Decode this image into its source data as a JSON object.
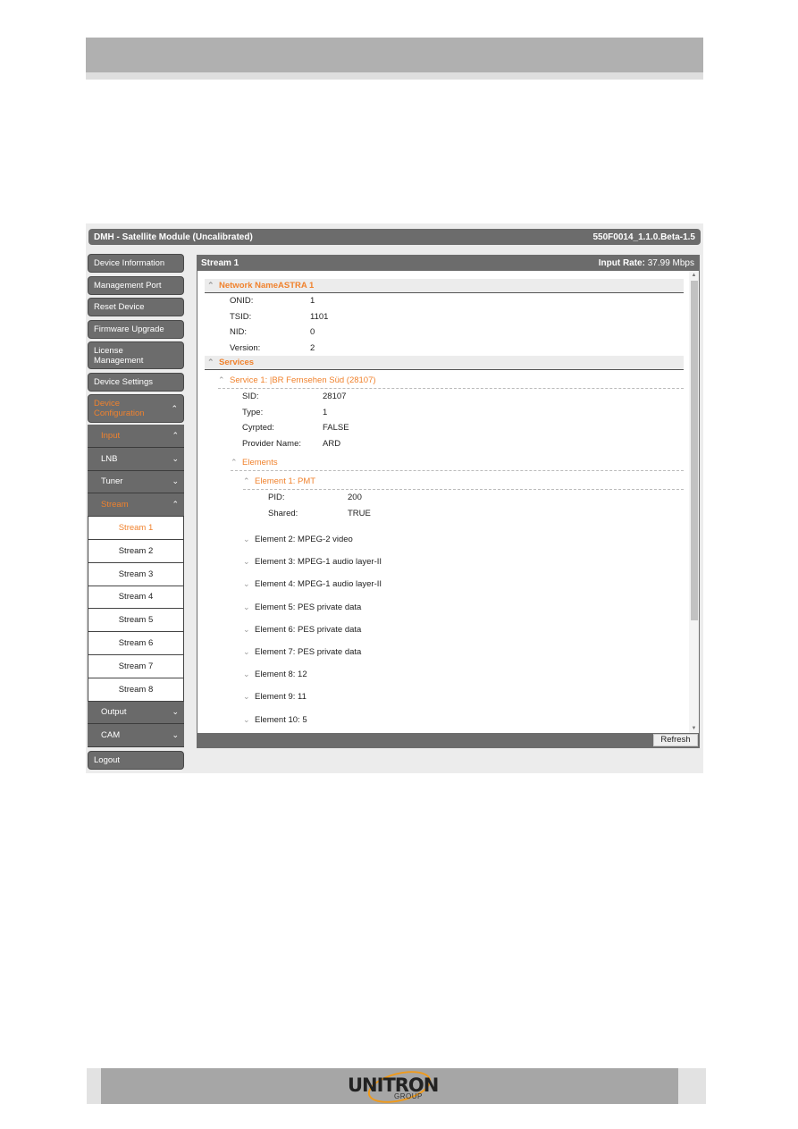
{
  "window": {
    "title": "DMH - Satellite Module (Uncalibrated)",
    "version": "550F0014_1.1.0.Beta-1.5"
  },
  "sidebar": {
    "items": [
      {
        "label": "Device Information"
      },
      {
        "label": "Management Port"
      },
      {
        "label": "Reset Device"
      },
      {
        "label": "Firmware Upgrade"
      },
      {
        "label": "License Management"
      },
      {
        "label": "Device Settings"
      },
      {
        "label": "Device Configuration",
        "expanded": true
      }
    ],
    "config": {
      "input": "Input",
      "lnb": "LNB",
      "tuner": "Tuner",
      "stream": "Stream",
      "streams": [
        "Stream 1",
        "Stream 2",
        "Stream 3",
        "Stream 4",
        "Stream 5",
        "Stream 6",
        "Stream 7",
        "Stream 8"
      ],
      "selected_stream": "Stream 1",
      "output": "Output",
      "cam": "CAM"
    },
    "logout": "Logout"
  },
  "content": {
    "title": "Stream 1",
    "input_rate_label": "Input Rate:",
    "input_rate_value": "37.99 Mbps",
    "network": {
      "header": "Network NameASTRA 1",
      "fields": [
        {
          "key": "ONID:",
          "value": "1"
        },
        {
          "key": "TSID:",
          "value": "1101"
        },
        {
          "key": "NID:",
          "value": "0"
        },
        {
          "key": "Version:",
          "value": "2"
        }
      ]
    },
    "services_header": "Services",
    "service": {
      "header": "Service 1: |BR Fernsehen Süd (28107)",
      "fields": [
        {
          "key": "SID:",
          "value": "28107"
        },
        {
          "key": "Type:",
          "value": "1"
        },
        {
          "key": "Cyrpted:",
          "value": "FALSE"
        },
        {
          "key": "Provider Name:",
          "value": "ARD"
        }
      ],
      "elements_header": "Elements",
      "element1": {
        "header": "Element 1: PMT",
        "fields": [
          {
            "key": "PID:",
            "value": "200"
          },
          {
            "key": "Shared:",
            "value": "TRUE"
          }
        ]
      },
      "collapsed_elements": [
        "Element 2: MPEG-2 video",
        "Element 3: MPEG-1 audio layer-II",
        "Element 4: MPEG-1 audio layer-II",
        "Element 5: PES private data",
        "Element 6: PES private data",
        "Element 7: PES private data",
        "Element 8: 12",
        "Element 9: 11",
        "Element 10: 5"
      ]
    },
    "refresh_label": "Refresh"
  },
  "footer": {
    "logo_text": "UNITRON",
    "logo_sub": "GROUP"
  },
  "colors": {
    "accent": "#f0822d",
    "bar": "#6c6c6c"
  }
}
